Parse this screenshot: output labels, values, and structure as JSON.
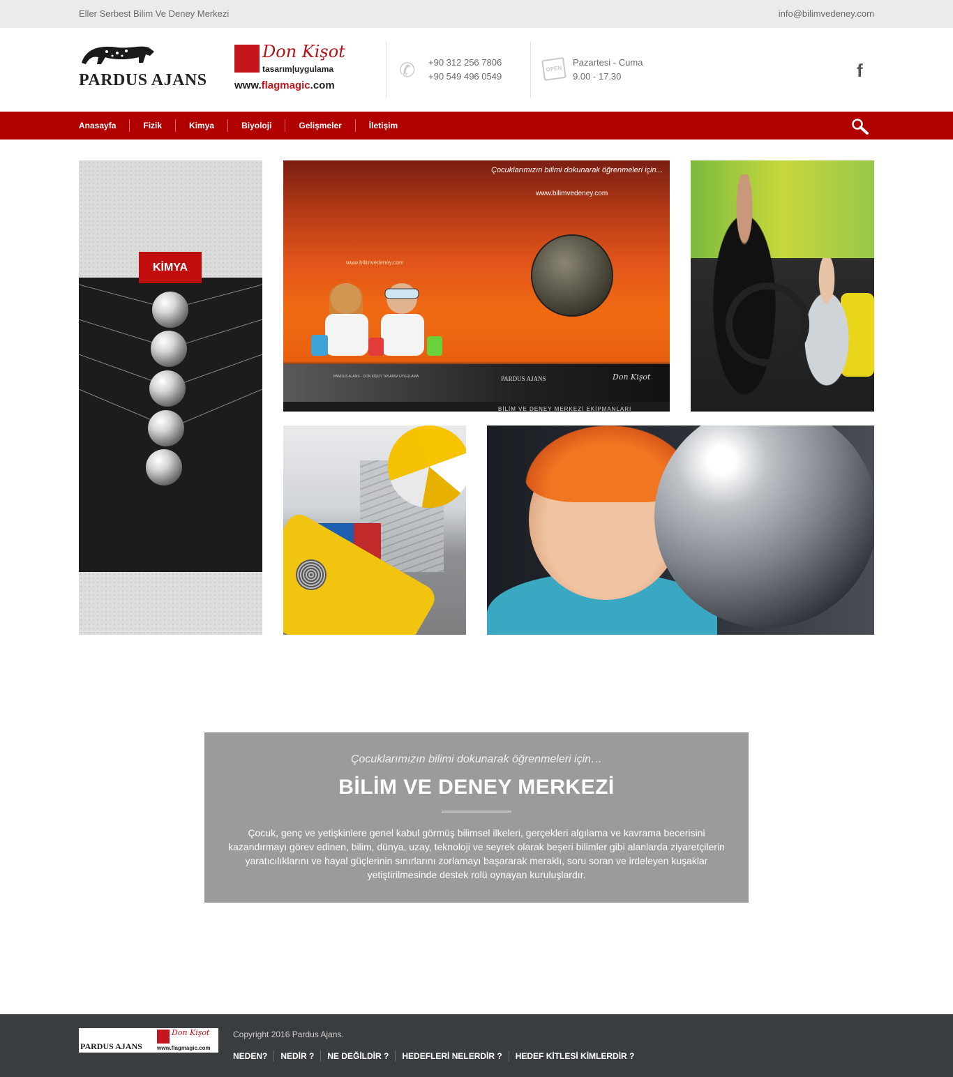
{
  "topbar": {
    "tagline": "Eller Serbest Bilim Ve Deney Merkezi",
    "email": "info@bilimvedeney.com"
  },
  "header": {
    "logo_pardus": "PARDUS AJANS",
    "logo_don_brand": "Don Kişot",
    "logo_don_sub": "tasarım|uygulama",
    "logo_don_url_prefix": "www.",
    "logo_don_url_brand": "flagmagic",
    "logo_don_url_suffix": ".com",
    "phone_1": "+90 312 256 7806",
    "phone_2": "+90 549 496 0549",
    "hours_days": "Pazartesi - Cuma",
    "hours_time": "9.00 - 17.30",
    "open_sign": "OPEN",
    "facebook_glyph": "f"
  },
  "nav": {
    "items": [
      "Anasayfa",
      "Fizik",
      "Kimya",
      "Biyoloji",
      "Gelişmeler",
      "İletişim"
    ]
  },
  "gallery": {
    "kimya_badge": "KİMYA",
    "poster_slogan": "Çocuklarımızın bilimi dokunarak öğrenmeleri için...",
    "poster_site": "www.bilimvedeney.com",
    "poster_site_small": "www.bilimvedeney.com",
    "poster_address": "PARDUS AJANS - DON KİŞOT TASARIM UYGULAMA",
    "poster_logo_pardus": "PARDUS AJANS",
    "poster_logo_don": "Don Kişot",
    "poster_bottom": "BİLİM VE DENEY MERKEZİ EKİPMANLARI"
  },
  "info": {
    "lead": "Çocuklarımızın bilimi dokunarak öğrenmeleri için…",
    "title": "BİLİM VE DENEY MERKEZİ",
    "body": "Çocuk, genç ve yetişkinlere genel kabul görmüş bilimsel ilkeleri, gerçekleri algılama ve kavrama becerisini kazandırmayı görev edinen, bilim, dünya, uzay, teknoloji ve seyrek olarak beşeri bilimler gibi alanlarda ziyaretçilerin yaratıcılıklarını ve hayal güçlerinin sınırlarını zorlamayı başararak meraklı, soru soran ve irdeleyen kuşaklar yetiştirilmesinde destek rolü oynayan kuruluşlardır."
  },
  "footer": {
    "logo_pardus": "PARDUS AJANS",
    "logo_don": "Don Kişot",
    "logo_url": "www.flagmagic.com",
    "copyright": "Copyright 2016 Pardus Ajans.",
    "links": [
      "NEDEN?",
      "NEDİR ?",
      "NE DEĞİLDİR ?",
      "HEDEFLERİ NELERDİR ?",
      "HEDEF KİTLESİ KİMLERDİR ?"
    ]
  },
  "colors": {
    "nav_red": "#b10000",
    "badge_red": "#c10d0d",
    "info_gray": "#9b9b9b",
    "footer_dark": "#3a3d40"
  },
  "icons": [
    "phone-icon",
    "open-sign-icon",
    "facebook-icon",
    "search-icon",
    "windmill-icon",
    "panther-icon"
  ]
}
